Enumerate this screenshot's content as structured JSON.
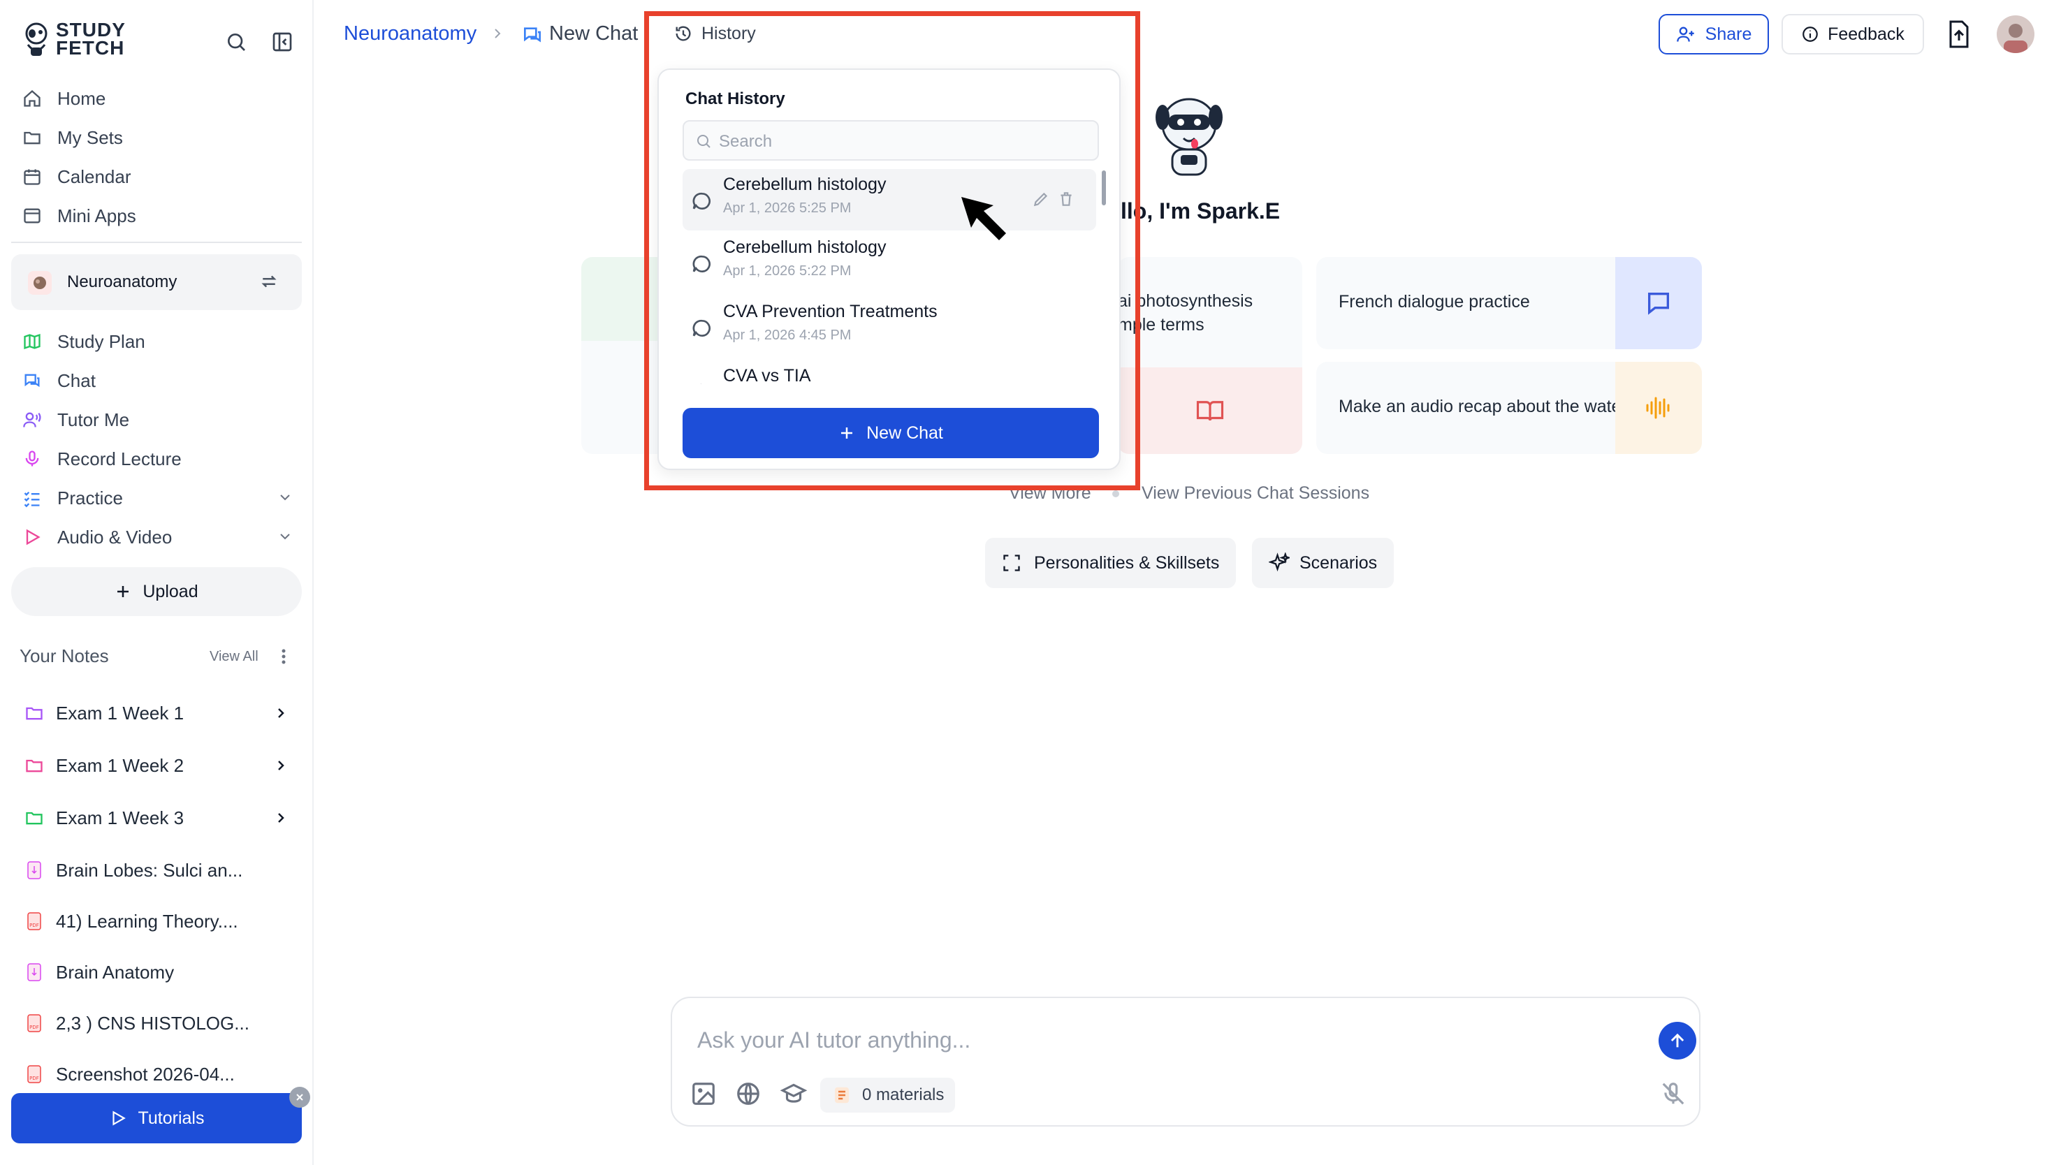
{
  "app": {
    "logo_line1": "STUDY",
    "logo_line2": "FETCH"
  },
  "sidebar": {
    "nav": [
      {
        "label": "Home",
        "icon": "home-icon"
      },
      {
        "label": "My Sets",
        "icon": "folder-icon"
      },
      {
        "label": "Calendar",
        "icon": "calendar-icon"
      },
      {
        "label": "Mini Apps",
        "icon": "mini-apps-icon"
      }
    ],
    "current_set": "Neuroanatomy",
    "set_nav": [
      {
        "label": "Study Plan",
        "icon": "map-icon"
      },
      {
        "label": "Chat",
        "icon": "chat-icon"
      },
      {
        "label": "Tutor Me",
        "icon": "tutor-icon"
      },
      {
        "label": "Record Lecture",
        "icon": "microphone-icon"
      },
      {
        "label": "Practice",
        "icon": "checklist-icon"
      },
      {
        "label": "Audio & Video",
        "icon": "play-icon"
      }
    ],
    "upload_label": "Upload",
    "notes_heading": "Your Notes",
    "view_all": "View All",
    "notes": [
      {
        "label": "Exam 1 Week 1",
        "type": "folder",
        "color": "#a855f7"
      },
      {
        "label": "Exam 1 Week 2",
        "type": "folder",
        "color": "#ec4899"
      },
      {
        "label": "Exam 1 Week 3",
        "type": "folder",
        "color": "#22c55e"
      },
      {
        "label": "Brain Lobes: Sulci an...",
        "type": "audio",
        "color": "#d946ef"
      },
      {
        "label": "41) Learning Theory....",
        "type": "pdf",
        "color": "#ef4444"
      },
      {
        "label": "Brain Anatomy",
        "type": "audio",
        "color": "#d946ef"
      },
      {
        "label": "2,3 ) CNS HISTOLOG...",
        "type": "pdf",
        "color": "#ef4444"
      },
      {
        "label": "Screenshot 2026-04...",
        "type": "pdf",
        "color": "#ef4444"
      }
    ],
    "tutorials_label": "Tutorials"
  },
  "header": {
    "breadcrumb_set": "Neuroanatomy",
    "breadcrumb_page": "New Chat",
    "history_label": "History",
    "share_label": "Share",
    "feedback_label": "Feedback"
  },
  "history": {
    "heading": "Chat History",
    "search_placeholder": "Search",
    "items": [
      {
        "title": "Cerebellum histology",
        "date": "Apr 1, 2026 5:25 PM"
      },
      {
        "title": "Cerebellum histology",
        "date": "Apr 1, 2026 5:22 PM"
      },
      {
        "title": "CVA Prevention Treatments",
        "date": "Apr 1, 2026 4:45 PM"
      },
      {
        "title": "CVA vs TIA",
        "date": ""
      }
    ],
    "new_chat_label": "New Chat"
  },
  "main": {
    "greeting": "llo, I'm Spark.E",
    "cards": [
      {
        "text1": "ai photosynthesis",
        "text2": "mple terms"
      },
      {
        "text": "French dialogue practice",
        "icon": "chat-bubble-icon",
        "color": "#3b5bdb"
      },
      {
        "text": "Make an audio recap about the water cycle",
        "icon": "audio-wave-icon",
        "color": "#f59e0b"
      }
    ],
    "view_more": "View More",
    "view_previous": "View Previous Chat Sessions",
    "personalities_label": "Personalities & Skillsets",
    "scenarios_label": "Scenarios",
    "input_placeholder": "Ask your AI tutor anything...",
    "materials_label": "0 materials"
  },
  "colors": {
    "primary": "#1d4ed8",
    "highlight": "#e8412c"
  }
}
